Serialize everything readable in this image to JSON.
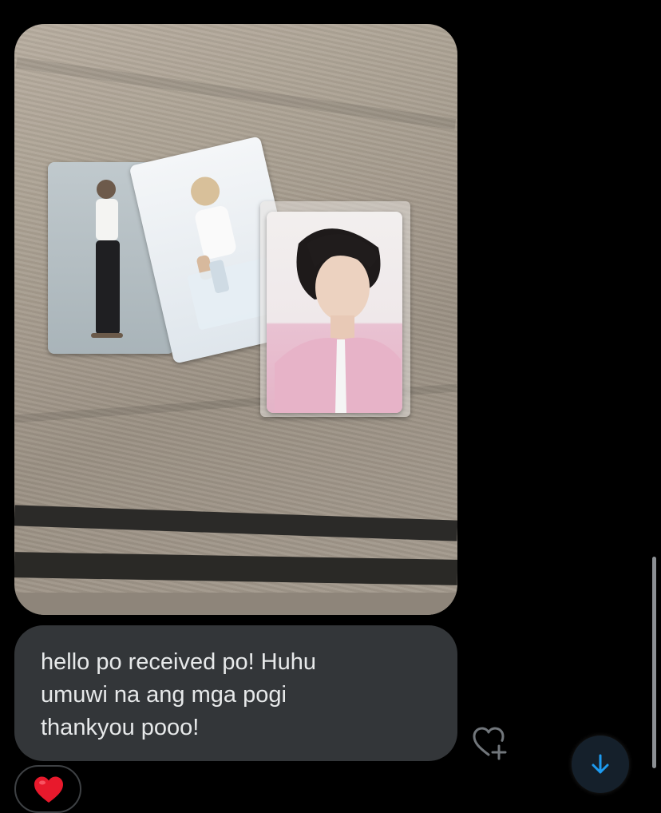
{
  "message": {
    "photo_alt": "Photo of three photocards on fabric",
    "lines": [
      "hello po received po! Huhu",
      "umuwi na ang mga pogi",
      "thankyou pooo!"
    ]
  },
  "reaction": {
    "emoji": "heart"
  },
  "icons": {
    "like": "heart-plus-icon",
    "scroll": "arrow-down-icon"
  },
  "colors": {
    "bubble": "#333639",
    "text": "#e7e9ea",
    "accent": "#1d9bf0",
    "background": "#000000"
  }
}
